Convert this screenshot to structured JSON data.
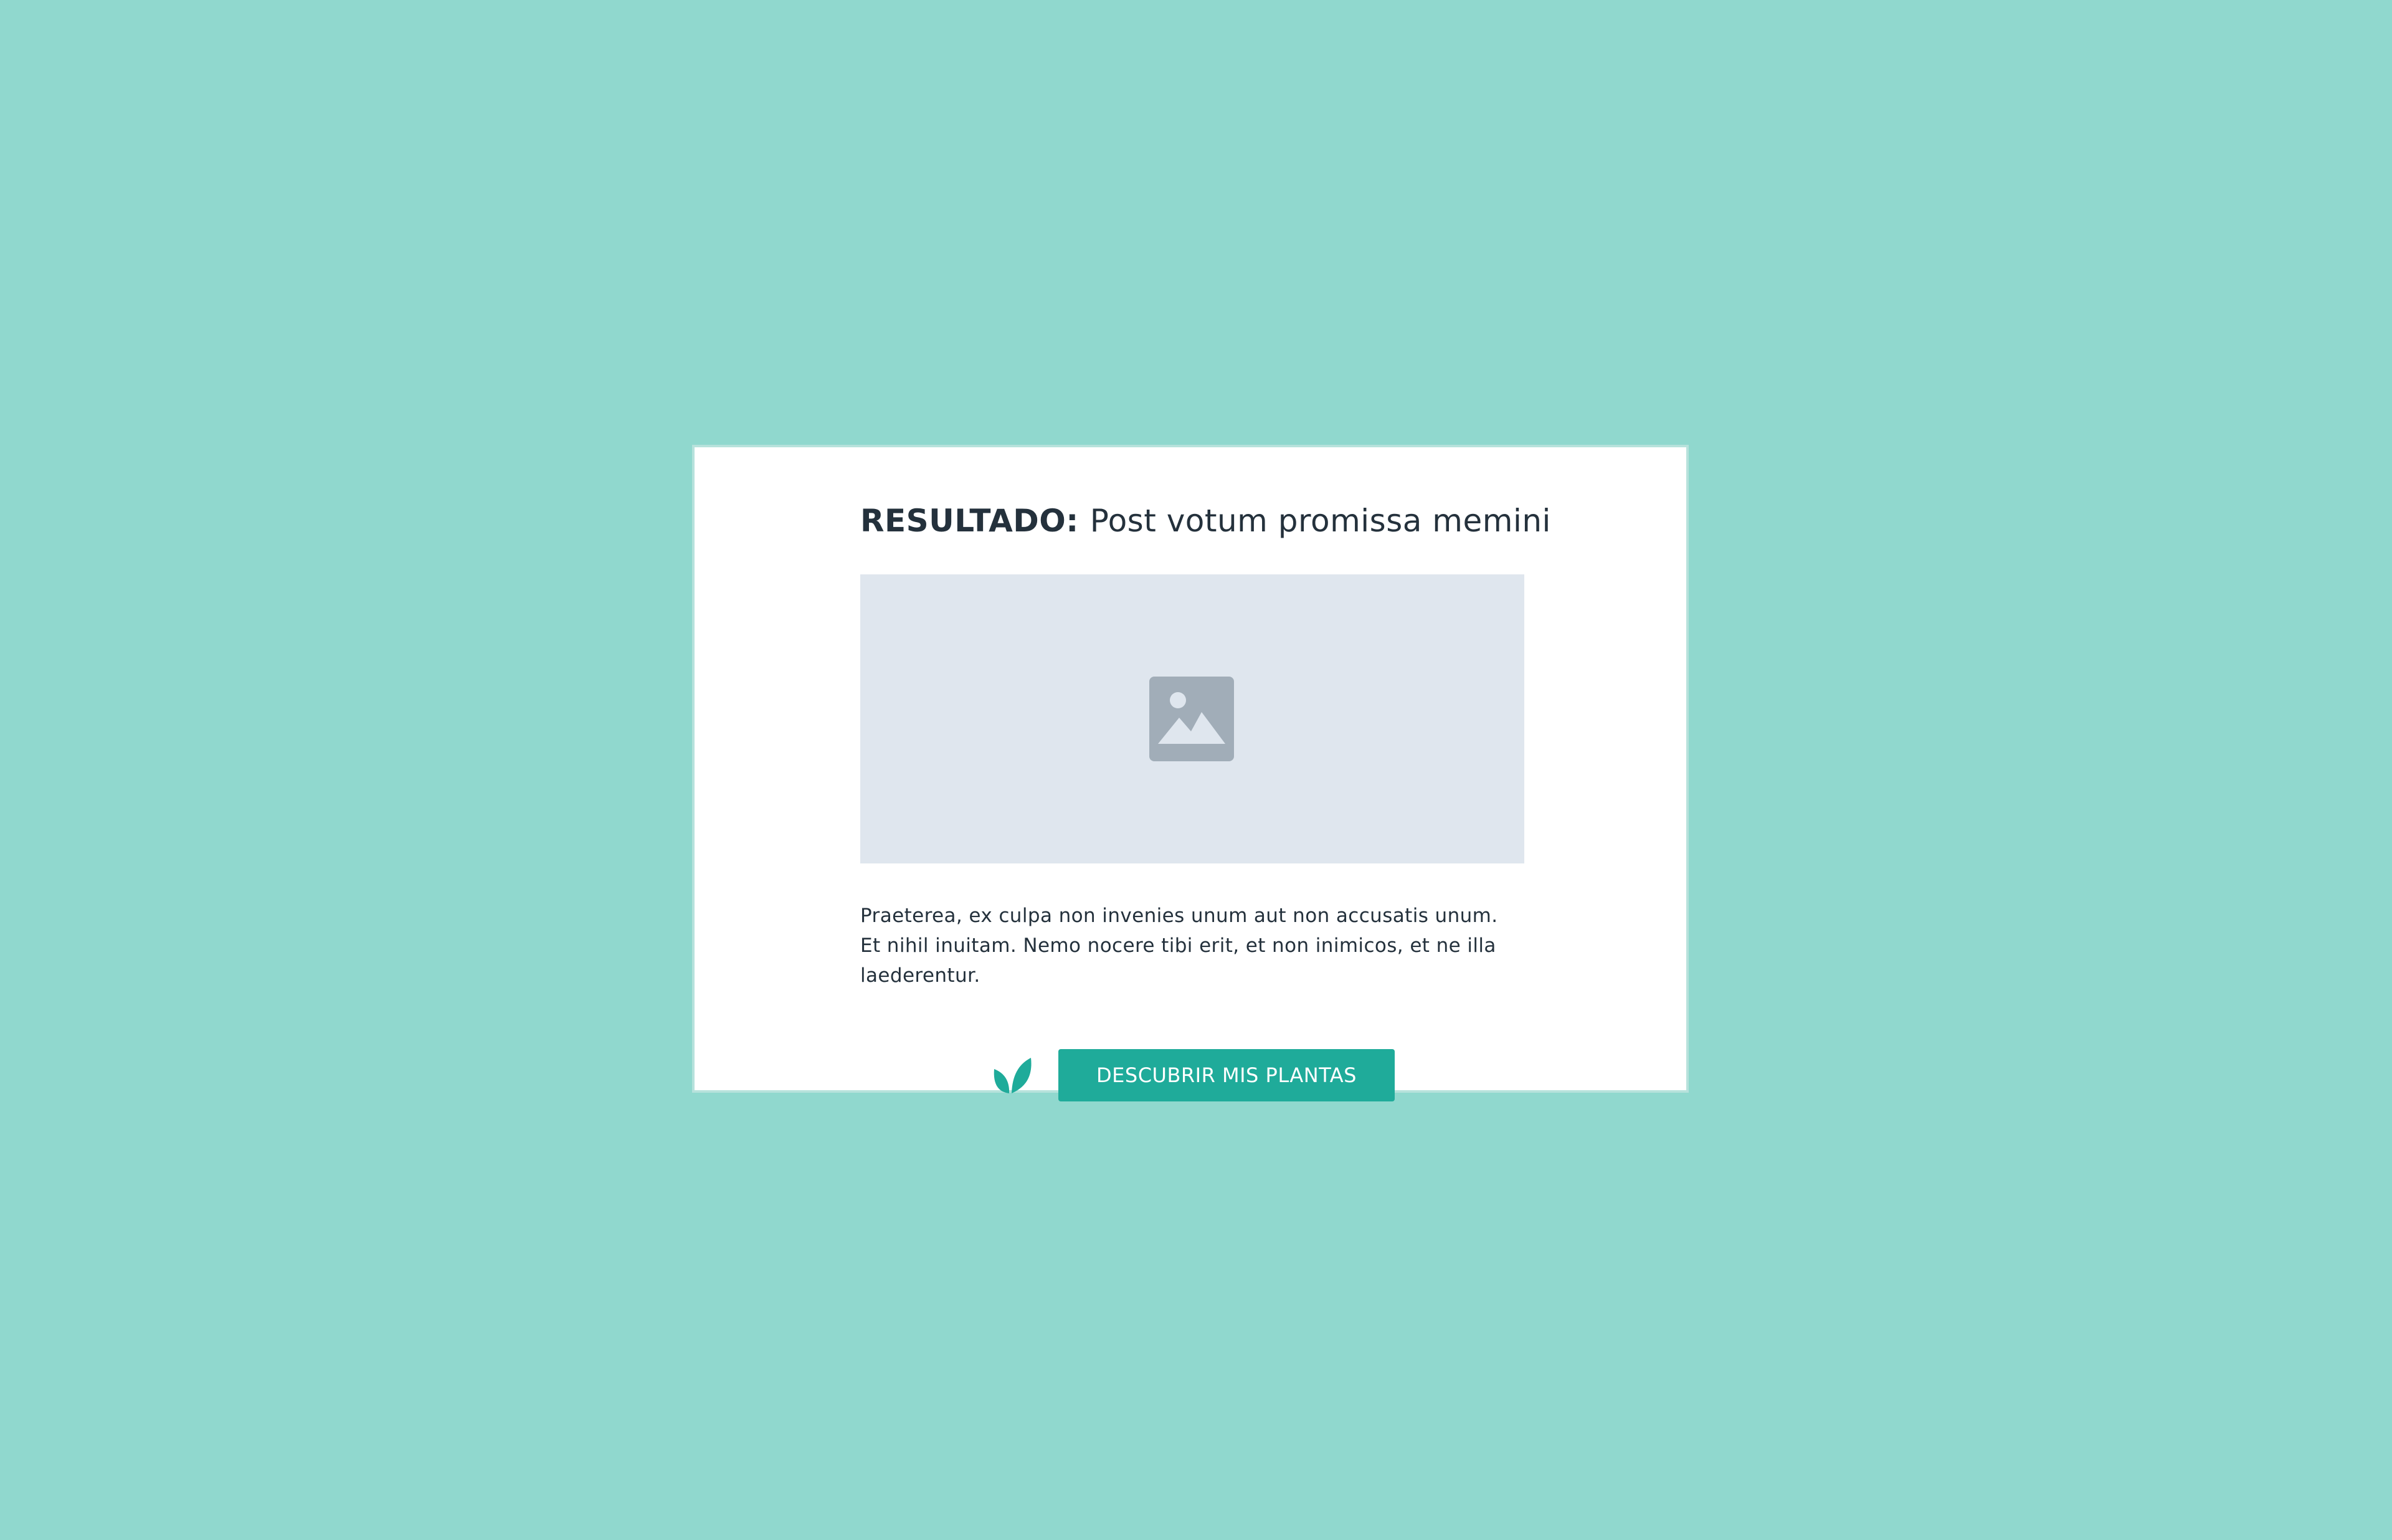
{
  "modal": {
    "title_label": "RESULTADO:",
    "title_text": "Post votum promissa memini",
    "image_icon": "image-placeholder-icon",
    "body": "Praeterea, ex culpa non invenies unum aut non accusatis unum. Et nihil inuitam. Nemo nocere tibi erit, et non inimicos, et ne illa laederentur.",
    "leaf_icon": "leaf-icon",
    "cta_label": "DESCUBRIR MIS PLANTAS"
  },
  "colors": {
    "background": "#90d8ce",
    "card": "#ffffff",
    "card_border": "#b7e2dc",
    "text": "#24313c",
    "placeholder": "#dfe6ee",
    "placeholder_icon": "#a1adb8",
    "accent": "#1fab9a"
  }
}
